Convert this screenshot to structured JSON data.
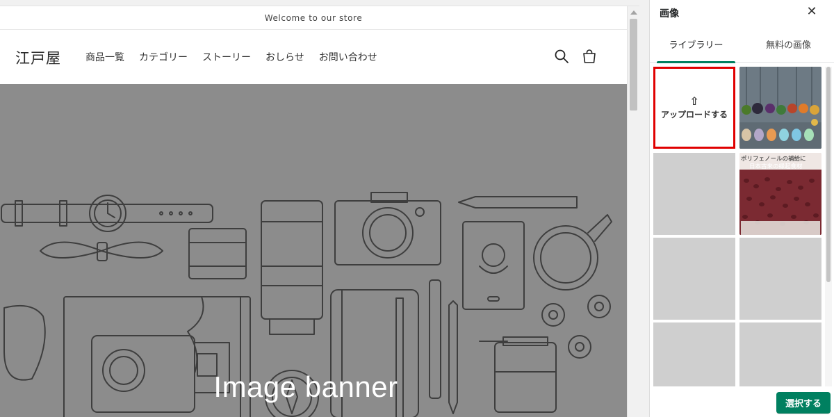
{
  "store": {
    "announcement": "Welcome to our store",
    "logo": "江戸屋",
    "nav": [
      "商品一覧",
      "カテゴリー",
      "ストーリー",
      "おしらせ",
      "お問い合わせ"
    ],
    "search_icon": "search-icon",
    "cart_icon": "cart-icon",
    "banner_title": "Image banner"
  },
  "panel": {
    "title": "画像",
    "close_icon": "close-icon",
    "tabs": [
      {
        "label": "ライブラリー",
        "active": true
      },
      {
        "label": "無料の画像",
        "active": false
      }
    ],
    "upload_icon": "upload-icon",
    "upload_label": "アップロードする",
    "thumb_overlay_text": "ポリフェノールの補給に",
    "thumb_overlay_text2": "日本古来の縁起食材",
    "select_label": "選択する"
  },
  "colors": {
    "accent": "#008060",
    "highlight": "#e00000",
    "banner_bg": "#8c8c8c",
    "placeholder": "#cfcfcf"
  }
}
